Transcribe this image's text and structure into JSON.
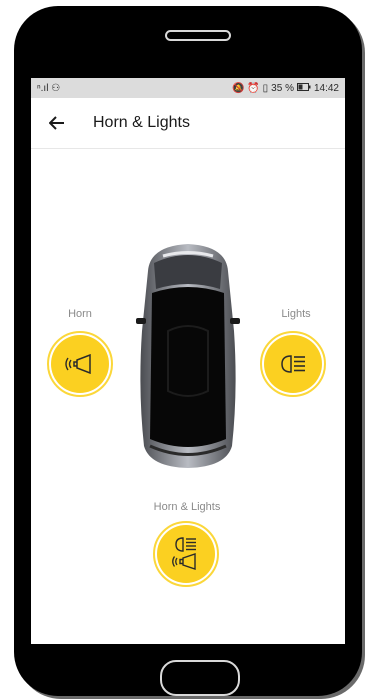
{
  "statusbar": {
    "left": "ⁿ.ıl ⚇",
    "right_icons": "🔕 ⏰ ▯",
    "battery_percent": "35 %",
    "time": "14:42"
  },
  "appbar": {
    "title": "Horn & Lights"
  },
  "actions": {
    "horn_label": "Horn",
    "lights_label": "Lights",
    "both_label": "Horn & Lights"
  },
  "colors": {
    "accent": "#fbd021",
    "ring": "#fbd73a"
  }
}
